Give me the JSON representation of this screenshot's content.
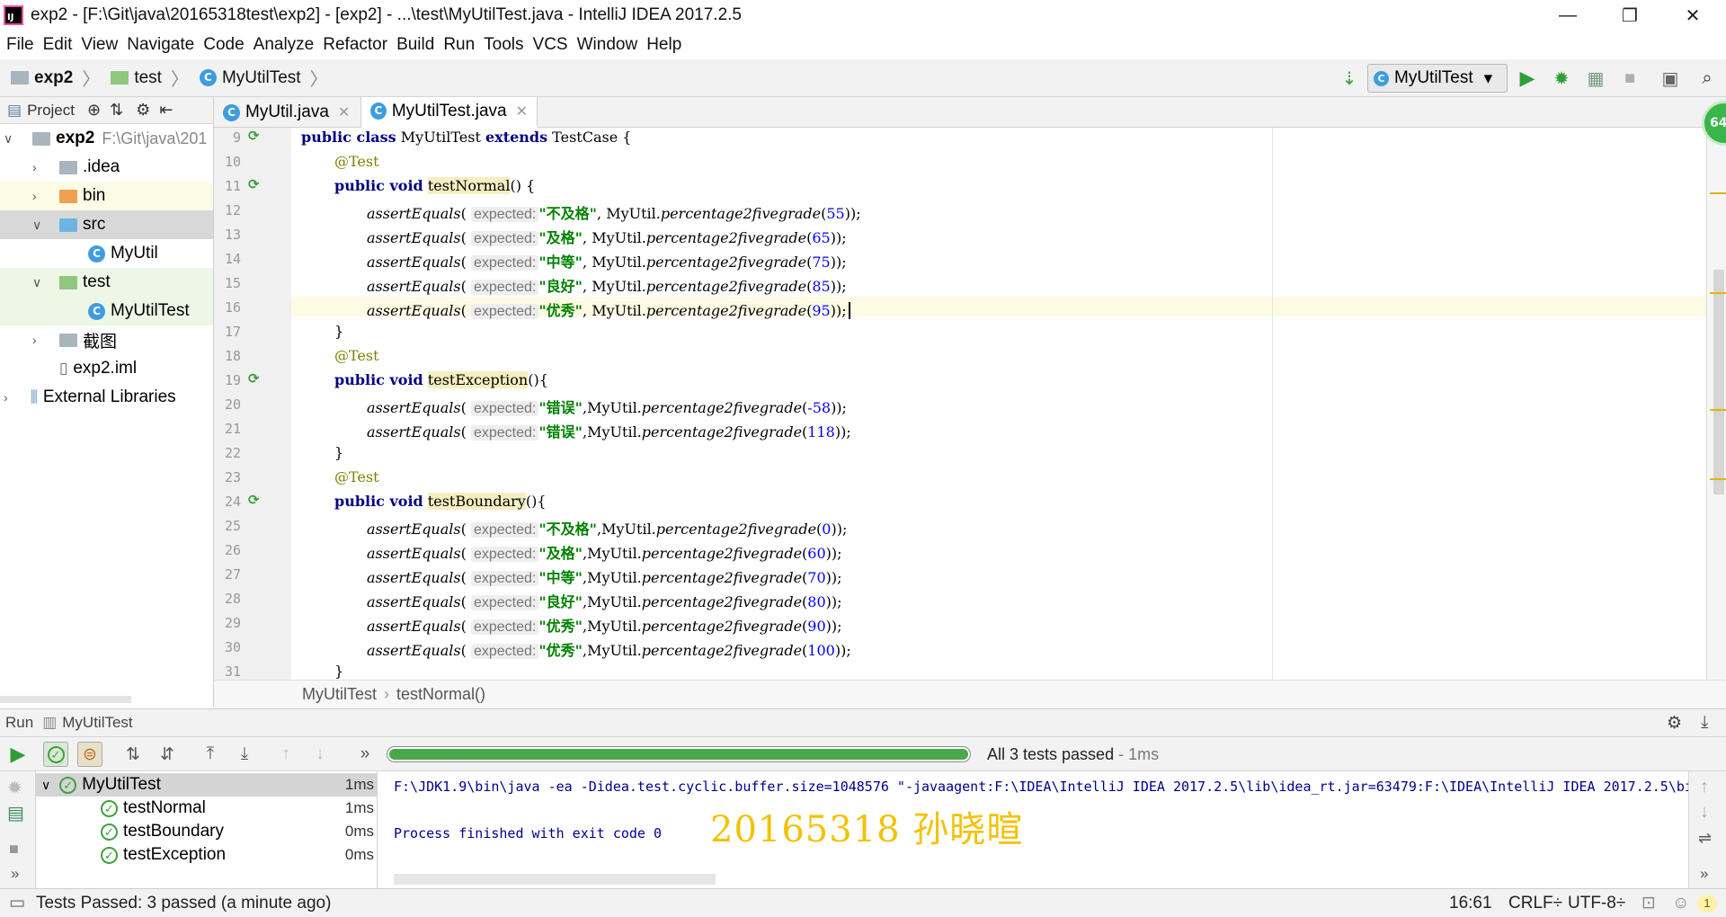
{
  "window": {
    "title": "exp2 - [F:\\Git\\java\\20165318test\\exp2] - [exp2] - ...\\test\\MyUtilTest.java - IntelliJ IDEA 2017.2.5",
    "logo_text": "IJ",
    "controls": {
      "minimize": "—",
      "restore": "❐",
      "close": "✕"
    }
  },
  "menu": [
    "File",
    "Edit",
    "View",
    "Navigate",
    "Code",
    "Analyze",
    "Refactor",
    "Build",
    "Run",
    "Tools",
    "VCS",
    "Window",
    "Help"
  ],
  "breadcrumb": {
    "project": "exp2",
    "folder": "test",
    "file": "MyUtilTest",
    "sep": "〉"
  },
  "toolbar": {
    "run_config": "MyUtilTest",
    "dropdown": "▾",
    "badge": "64"
  },
  "project_panel": {
    "header": "Project",
    "tree": [
      {
        "label": "exp2",
        "sub": "F:\\Git\\java\\201",
        "arrow": "∨"
      },
      {
        "label": ".idea",
        "arrow": "›"
      },
      {
        "label": "bin",
        "arrow": "›"
      },
      {
        "label": "src",
        "arrow": "∨"
      },
      {
        "label": "MyUtil"
      },
      {
        "label": "test",
        "arrow": "∨"
      },
      {
        "label": "MyUtilTest"
      },
      {
        "label": "截图",
        "arrow": "›"
      },
      {
        "label": "exp2.iml"
      },
      {
        "label": "External Libraries",
        "arrow": "›"
      }
    ]
  },
  "tabs": [
    {
      "label": "MyUtil.java",
      "close": "✕"
    },
    {
      "label": "MyUtilTest.java",
      "close": "✕"
    }
  ],
  "editor": {
    "line_numbers": [
      "9",
      "10",
      "11",
      "12",
      "13",
      "14",
      "15",
      "16",
      "17",
      "18",
      "19",
      "20",
      "21",
      "22",
      "23",
      "24",
      "25",
      "26",
      "27",
      "28",
      "29",
      "30",
      "31"
    ],
    "class_decl": {
      "kw1": "public class",
      "name": " MyUtilTest ",
      "kw2": "extends",
      "parent": " TestCase {"
    },
    "annotation": "@Test",
    "method_prefix": "public void",
    "methods": [
      "testNormal",
      "testException",
      "testBoundary"
    ],
    "method_suffix_1": "() {",
    "method_suffix_2": "(){",
    "close_brace": "}",
    "assert_fn": "assertEquals",
    "hint": "expected:",
    "call": "MyUtil.",
    "call_fn": "percentage2fivegrade",
    "normal_args": [
      {
        "str": "\"不及格\"",
        "num": "55"
      },
      {
        "str": "\"及格\"",
        "num": "65"
      },
      {
        "str": "\"中等\"",
        "num": "75"
      },
      {
        "str": "\"良好\"",
        "num": "85"
      },
      {
        "str": "\"优秀\"",
        "num": "95"
      }
    ],
    "exception_args": [
      {
        "str": "\"错误\"",
        "num": "-58"
      },
      {
        "str": "\"错误\"",
        "num": "118"
      }
    ],
    "boundary_args": [
      {
        "str": "\"不及格\"",
        "num": "0"
      },
      {
        "str": "\"及格\"",
        "num": "60"
      },
      {
        "str": "\"中等\"",
        "num": "70"
      },
      {
        "str": "\"良好\"",
        "num": "80"
      },
      {
        "str": "\"优秀\"",
        "num": "90"
      },
      {
        "str": "\"优秀\"",
        "num": "100"
      }
    ],
    "breadcrumb": {
      "class": "MyUtilTest",
      "sep": "›",
      "method": "testNormal()"
    }
  },
  "run_panel": {
    "header_label": "Run",
    "config": "MyUtilTest",
    "status": "All 3 tests passed",
    "status_time": " - 1ms",
    "progress": 1.0,
    "tests": [
      {
        "name": "MyUtilTest",
        "time": "1ms"
      },
      {
        "name": "testNormal",
        "time": "1ms"
      },
      {
        "name": "testBoundary",
        "time": "0ms"
      },
      {
        "name": "testException",
        "time": "0ms"
      }
    ],
    "console": [
      "F:\\JDK1.9\\bin\\java -ea -Didea.test.cyclic.buffer.size=1048576 \"-javaagent:F:\\IDEA\\IntelliJ IDEA 2017.2.5\\lib\\idea_rt.jar=63479:F:\\IDEA\\IntelliJ IDEA 2017.2.5\\bi",
      "Process finished with exit code 0"
    ],
    "watermark": "20165318 孙晓暄"
  },
  "statusbar": {
    "message": "Tests Passed: 3 passed (a minute ago)",
    "position": "16:61",
    "line_sep": "CRLF÷",
    "encoding": "UTF-8÷",
    "badge": "1"
  },
  "colors": {
    "accent_green": "#49a84c",
    "keyword": "#000080",
    "string": "#008000",
    "number": "#0000ff",
    "annotation": "#808000"
  }
}
